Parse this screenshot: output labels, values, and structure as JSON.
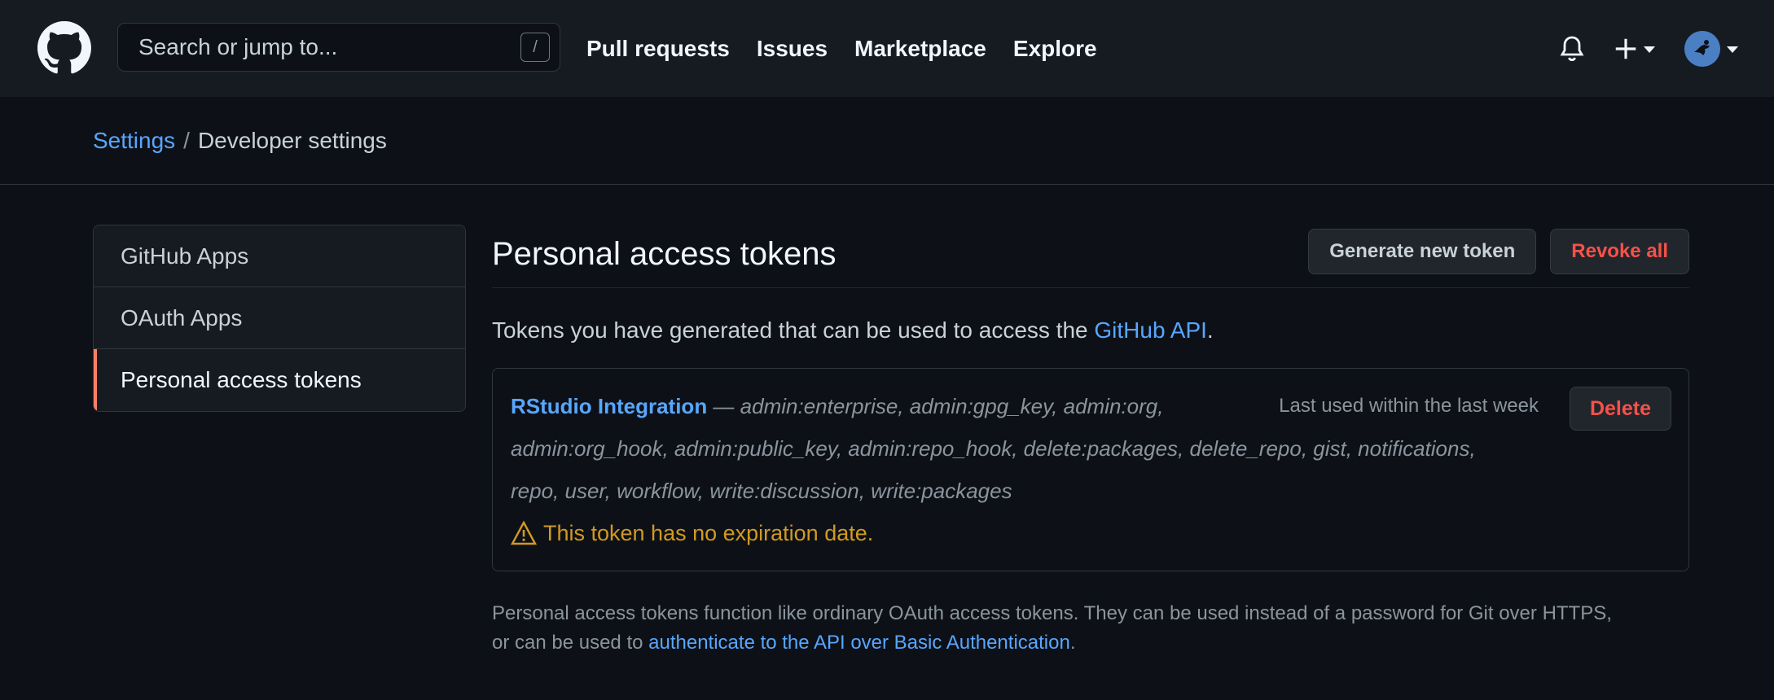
{
  "header": {
    "search_placeholder": "Search or jump to...",
    "search_shortcut": "/",
    "nav": [
      "Pull requests",
      "Issues",
      "Marketplace",
      "Explore"
    ],
    "icons": [
      "github-logo-icon",
      "bell-icon",
      "plus-icon",
      "avatar"
    ]
  },
  "breadcrumb": {
    "root": "Settings",
    "separator": "/",
    "current": "Developer settings"
  },
  "sidebar": {
    "items": [
      {
        "label": "GitHub Apps",
        "active": false
      },
      {
        "label": "OAuth Apps",
        "active": false
      },
      {
        "label": "Personal access tokens",
        "active": true
      }
    ]
  },
  "main": {
    "title": "Personal access tokens",
    "generate_button": "Generate new token",
    "revoke_button": "Revoke all",
    "description_prefix": "Tokens you have generated that can be used to access the ",
    "description_link": "GitHub API",
    "description_suffix": ".",
    "token": {
      "name": "RStudio Integration",
      "dash": " — ",
      "scopes_line1": "admin:enterprise, admin:gpg_key, admin:org,",
      "scopes_line2": "admin:org_hook, admin:public_key, admin:repo_hook, delete:packages, delete_repo, gist, notifications,",
      "scopes_line3": "repo, user, workflow, write:discussion, write:packages",
      "last_used": "Last used within the last week",
      "delete_button": "Delete",
      "warning": "This token has no expiration date."
    },
    "footer_line1": "Personal access tokens function like ordinary OAuth access tokens. They can be used instead of a password for Git over HTTPS,",
    "footer_line2_prefix": "or can be used to ",
    "footer_link": "authenticate to the API over Basic Authentication",
    "footer_line2_suffix": "."
  },
  "colors": {
    "accent_link": "#58a6ff",
    "danger": "#f85149",
    "warning": "#d29922",
    "active_marker": "#f78166",
    "header_bg": "#161b22",
    "page_bg": "#0d1117"
  }
}
